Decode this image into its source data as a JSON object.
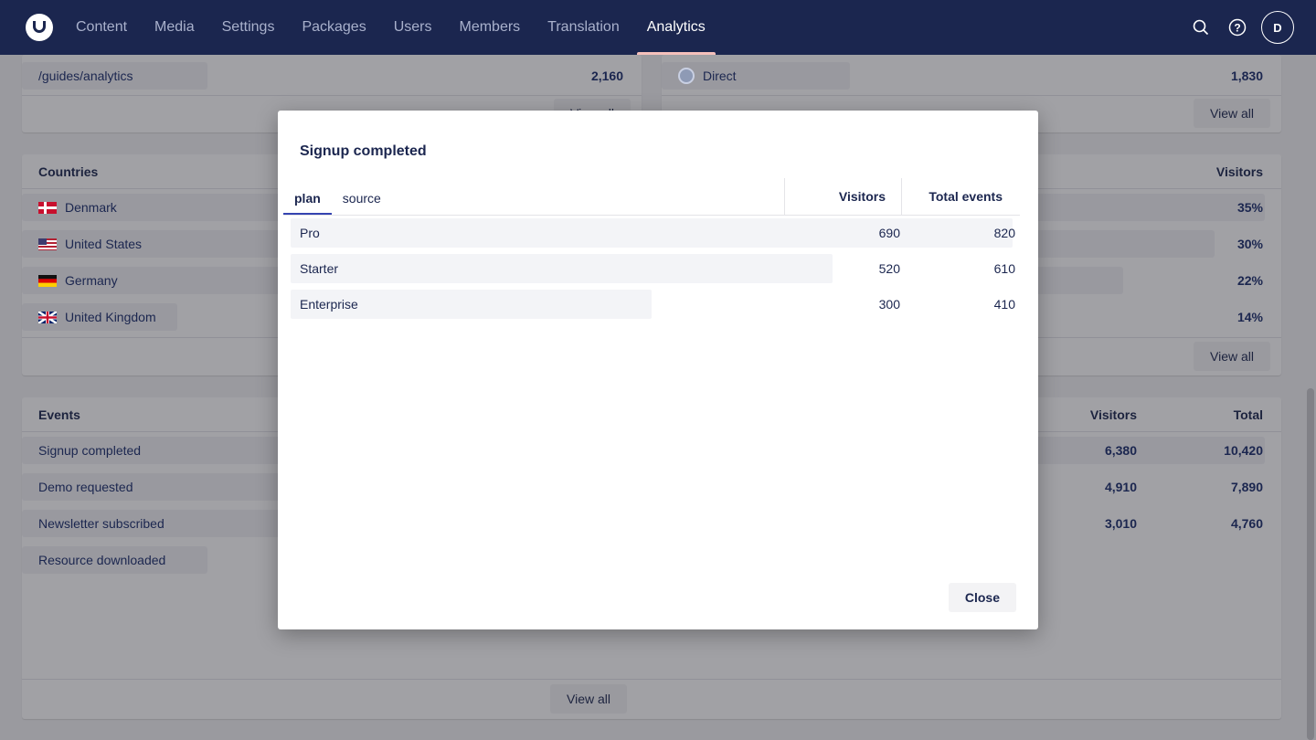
{
  "nav": {
    "items": [
      "Content",
      "Media",
      "Settings",
      "Packages",
      "Users",
      "Members",
      "Translation",
      "Analytics"
    ],
    "active": "Analytics",
    "avatar": "D"
  },
  "pages_panel": {
    "row_label": "/guides/analytics",
    "row_value": "2,160",
    "view_all": "View all"
  },
  "sources_panel": {
    "row_label": "Direct",
    "row_value": "1,830",
    "view_all": "View all"
  },
  "countries_panel": {
    "title": "Countries",
    "col": "Visitors",
    "rows": [
      {
        "label": "Denmark",
        "value": "35%"
      },
      {
        "label": "United States",
        "value": "30%"
      },
      {
        "label": "Germany",
        "value": "22%"
      },
      {
        "label": "United Kingdom",
        "value": "14%"
      }
    ],
    "view_all": "View all"
  },
  "events_panel": {
    "title": "Events",
    "col_visitors": "Visitors",
    "col_total": "Total",
    "rows": [
      {
        "label": "Signup completed",
        "visitors": "6,380",
        "total": "10,420"
      },
      {
        "label": "Demo requested",
        "visitors": "4,910",
        "total": "7,890"
      },
      {
        "label": "Newsletter subscribed",
        "visitors": "3,010",
        "total": "4,760"
      },
      {
        "label": "Resource downloaded",
        "visitors": "",
        "total": ""
      }
    ],
    "view_all": "View all"
  },
  "modal": {
    "title": "Signup completed",
    "tabs": [
      "plan",
      "source"
    ],
    "active_tab": "plan",
    "col_visitors": "Visitors",
    "col_total": "Total events",
    "rows": [
      {
        "label": "Pro",
        "visitors": "690",
        "total": "820",
        "share": 1.0
      },
      {
        "label": "Starter",
        "visitors": "520",
        "total": "610",
        "share": 0.75
      },
      {
        "label": "Enterprise",
        "visitors": "300",
        "total": "410",
        "share": 0.5
      }
    ],
    "close": "Close"
  }
}
